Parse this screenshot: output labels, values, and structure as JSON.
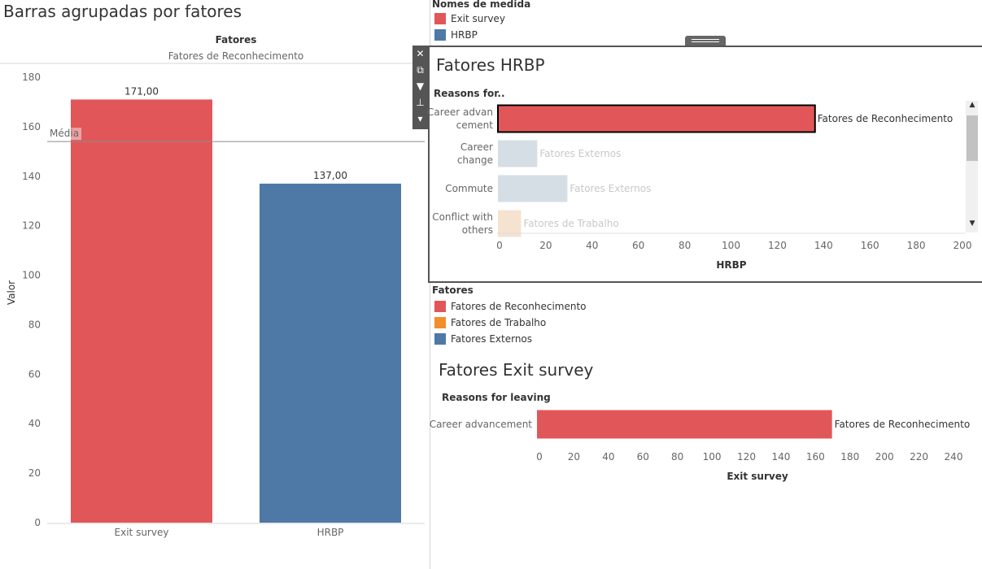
{
  "main_title": "Barras agrupadas por fatores",
  "legend_measures": {
    "title": "Nomes de medida",
    "items": [
      {
        "label": "Exit survey",
        "color": "#e15759"
      },
      {
        "label": "HRBP",
        "color": "#4e79a7"
      }
    ]
  },
  "legend_fatores": {
    "title": "Fatores",
    "items": [
      {
        "label": "Fatores de Reconhecimento",
        "color": "#e15759"
      },
      {
        "label": "Fatores de Trabalho",
        "color": "#f28e2b"
      },
      {
        "label": "Fatores Externos",
        "color": "#4e79a7"
      }
    ]
  },
  "hrbp_panel": {
    "title": "Fatores HRBP",
    "row_header": "Reasons for.."
  },
  "exit_panel": {
    "title": "Fatores Exit survey",
    "row_header": "Reasons for leaving"
  },
  "toolbar": {
    "close_icon": "✕",
    "popout_icon": "⧉",
    "filter_icon": "▼",
    "pin_icon": "⊥",
    "menu_icon": "▾"
  },
  "chart_data": [
    {
      "type": "bar",
      "title": "",
      "column_header": "Fatores",
      "column_value": "Fatores de Reconhecimento",
      "categories": [
        "Exit survey",
        "HRBP"
      ],
      "values": [
        171,
        137
      ],
      "value_labels": [
        "171,00",
        "137,00"
      ],
      "colors": [
        "#e15759",
        "#4e79a7"
      ],
      "ylabel": "Valor",
      "ylim": [
        0,
        180
      ],
      "yticks": [
        0,
        20,
        40,
        60,
        80,
        100,
        120,
        140,
        160,
        180
      ],
      "reference_line": {
        "label": "Média",
        "value": 154
      }
    },
    {
      "type": "bar",
      "orientation": "horizontal",
      "title": "Fatores HRBP",
      "categories": [
        {
          "label_lines": [
            "Career advan",
            "cement"
          ]
        },
        {
          "label_lines": [
            "Career",
            "change"
          ]
        },
        {
          "label_lines": [
            "Commute"
          ]
        },
        {
          "label_lines": [
            "Conflict with",
            "others"
          ]
        }
      ],
      "values": [
        137,
        17,
        30,
        10
      ],
      "factor_labels": [
        "Fatores de Reconhecimento",
        "Fatores Externos",
        "Fatores Externos",
        "Fatores de Trabalho"
      ],
      "colors": [
        "#e15759",
        "#d5dde5",
        "#d5dde5",
        "#f5e2cf"
      ],
      "label_colors": [
        "#333333",
        "#c8c8c8",
        "#c8c8c8",
        "#c8c8c8"
      ],
      "selected_index": 0,
      "xlabel": "HRBP",
      "xlim": [
        0,
        200
      ],
      "xticks": [
        0,
        20,
        40,
        60,
        80,
        100,
        120,
        140,
        160,
        180,
        200
      ]
    },
    {
      "type": "bar",
      "orientation": "horizontal",
      "title": "Fatores Exit survey",
      "categories": [
        {
          "label_lines": [
            "Career advancement"
          ]
        }
      ],
      "values": [
        171
      ],
      "factor_labels": [
        "Fatores de Reconhecimento"
      ],
      "colors": [
        "#e15759"
      ],
      "label_colors": [
        "#333333"
      ],
      "xlabel": "Exit survey",
      "xlim": [
        0,
        240
      ],
      "xticks": [
        0,
        20,
        40,
        60,
        80,
        100,
        120,
        140,
        160,
        180,
        200,
        220,
        240
      ]
    }
  ]
}
